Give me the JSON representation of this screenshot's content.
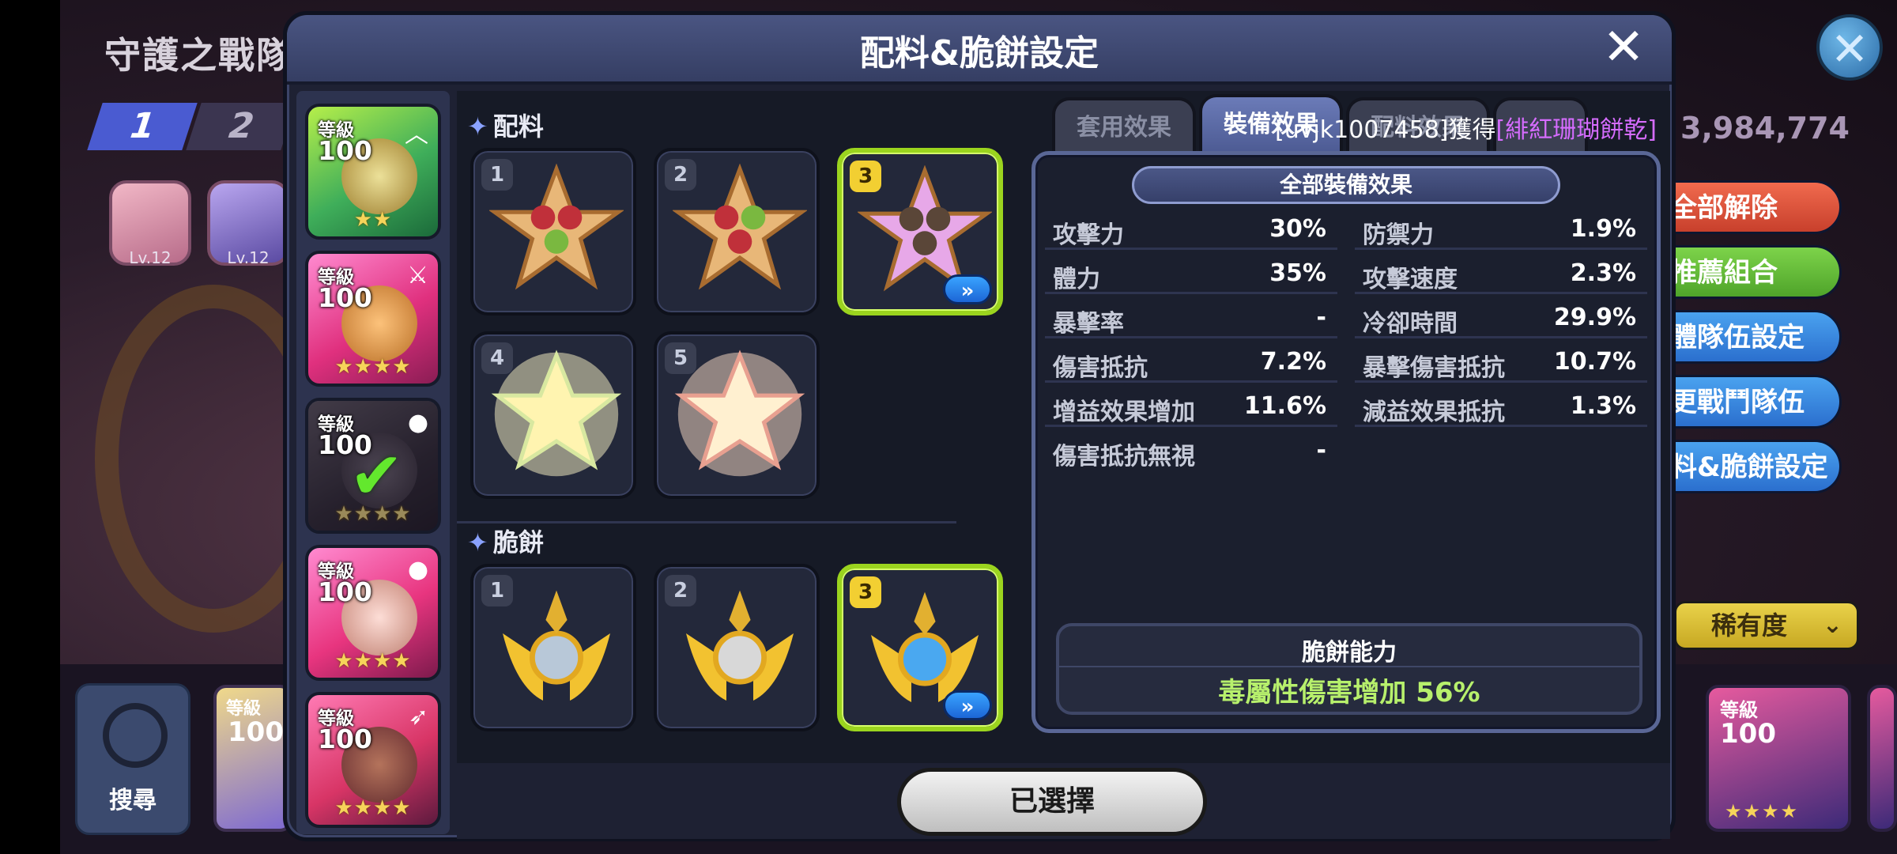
{
  "background": {
    "title": "守護之戰隊",
    "tabs": [
      "1",
      "2"
    ],
    "chips": [
      {
        "level": "Lv.12",
        "color": "#e7a8bf"
      },
      {
        "level": "Lv.12",
        "color": "#9a86d8"
      }
    ],
    "score": "3,984,774",
    "menu": [
      {
        "label": "全部解除",
        "color": "red"
      },
      {
        "label": "推薦組合",
        "color": "green"
      },
      {
        "label": "體隊伍設定",
        "color": "blue"
      },
      {
        "label": "更戰鬥隊伍",
        "color": "blue"
      },
      {
        "label": "料&脆餅設定",
        "color": "blue"
      }
    ],
    "rarity_label": "稀有度",
    "search_label": "搜尋",
    "bottom_cards": [
      {
        "level_label": "等級",
        "level": "100"
      },
      {
        "level_label": "等級",
        "level": "100"
      }
    ]
  },
  "modal": {
    "title": "配料&脆餅設定",
    "close_icon": "close-icon"
  },
  "cookies": [
    {
      "level_label": "等級",
      "level": "100",
      "stars": "★★",
      "corner": "chevron-up-icon"
    },
    {
      "level_label": "等級",
      "level": "100",
      "stars": "★★★★",
      "corner": "sword-icon"
    },
    {
      "level_label": "等級",
      "level": "100",
      "stars": "★★★★",
      "corner": "bomb-icon",
      "checked": true
    },
    {
      "level_label": "等級",
      "level": "100",
      "stars": "★★★★",
      "corner": "bomb-icon"
    },
    {
      "level_label": "等級",
      "level": "100",
      "stars": "★★★★",
      "corner": "arrow-icon"
    }
  ],
  "toppings": {
    "header": "配料",
    "slots": [
      {
        "num": "1",
        "selected": false
      },
      {
        "num": "2",
        "selected": false
      },
      {
        "num": "3",
        "selected": true
      },
      {
        "num": "4",
        "selected": false
      },
      {
        "num": "5",
        "selected": false
      }
    ]
  },
  "tarts": {
    "header": "脆餅",
    "slots": [
      {
        "num": "1",
        "selected": false
      },
      {
        "num": "2",
        "selected": false
      },
      {
        "num": "3",
        "selected": true
      }
    ]
  },
  "tabs": [
    {
      "label": "套用效果",
      "active": false
    },
    {
      "label": "裝備效果",
      "active": true
    },
    {
      "label": "配料效果",
      "active": false
    }
  ],
  "notice": {
    "prefix": "[uvjk1007458]獲得",
    "highlight": "[緋紅珊瑚餅乾]"
  },
  "effects": {
    "header": "全部裝備效果",
    "left": [
      {
        "key": "攻擊力",
        "value": "30%"
      },
      {
        "key": "體力",
        "value": "35%"
      },
      {
        "key": "暴擊率",
        "value": "-"
      },
      {
        "key": "傷害抵抗",
        "value": "7.2%"
      },
      {
        "key": "增益效果增加",
        "value": "11.6%"
      },
      {
        "key": "傷害抵抗無視",
        "value": "-"
      }
    ],
    "right": [
      {
        "key": "防禦力",
        "value": "1.9%"
      },
      {
        "key": "攻擊速度",
        "value": "2.3%"
      },
      {
        "key": "冷卻時間",
        "value": "29.9%"
      },
      {
        "key": "暴擊傷害抵抗",
        "value": "10.7%"
      },
      {
        "key": "減益效果抵抗",
        "value": "1.3%"
      }
    ],
    "ability_title": "脆餅能力",
    "ability_value": "毒屬性傷害增加 56%"
  },
  "footer": {
    "selected_label": "已選擇"
  }
}
